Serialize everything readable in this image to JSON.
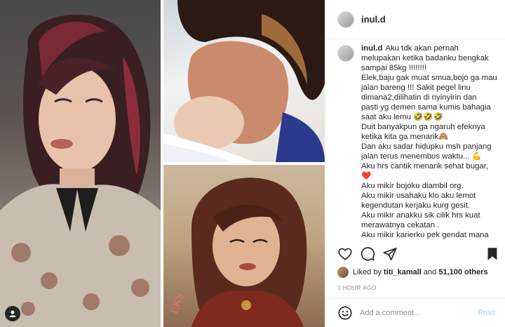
{
  "post": {
    "username": "inul.d",
    "caption_lines": [
      "Aku tdk akan pernah",
      "melupakan ketika badanku bengkak",
      "sampai 85kg !!!!!!!!",
      "Elek,baju gak muat smua,bojo ga mau",
      "jalan bareng !!! Sakit pegel linu",
      "dimana2,dilihatin di nyinyirin dan",
      "pasti yg demen sama kumis bahagia",
      "saat aku lemu 🤣🤣🤣",
      "Duit banyakpun ga ngaruh efeknya",
      "ketika kita ga menarik🙈",
      "Dan aku sadar hidupku msh panjang",
      "jalan terus menembus waktu... 💪",
      "Aku hrs cantik menarik sehat bugar,",
      "❤️",
      "Aku mikir bojoku diambil org.",
      "Aku mikir usahaku klo aku lemot",
      "kegendutan kerjaku kurg gesit.",
      "Aku mikir anakku sik cilik hrs kuat",
      "merawatnya cekatan .",
      "Aku mikir karierku pek gendat mana"
    ],
    "likes": {
      "prefix": "Liked by",
      "first_user": "titi_kamall",
      "joiner": "and",
      "others": "51,100 others"
    },
    "timestamp": "1 HOUR AGO"
  },
  "comment": {
    "placeholder": "Add a comment...",
    "post_label": "Post"
  },
  "icons": {
    "like": "heart-icon",
    "comment": "comment-icon",
    "share": "share-icon",
    "save": "bookmark-icon",
    "emoji": "emoji-icon"
  },
  "colors": {
    "accent": "#0095f6",
    "post_disabled": "#b2dffc",
    "border": "#efefef"
  }
}
